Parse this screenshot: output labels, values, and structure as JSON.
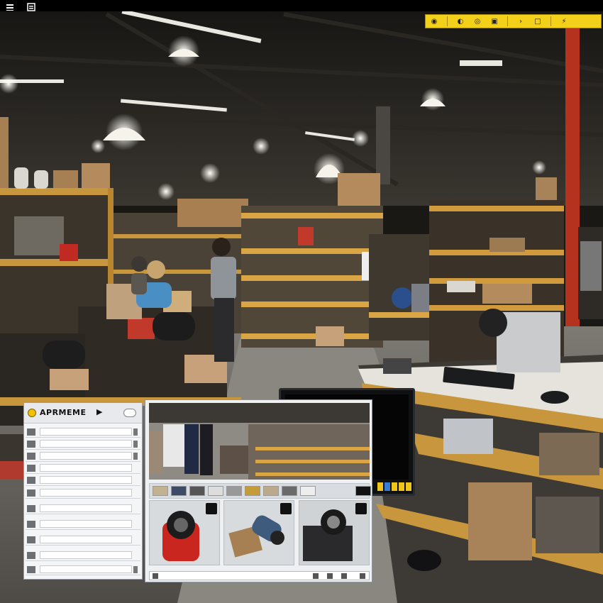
{
  "toolbar": {
    "icons": [
      "target-icon",
      "eye-icon",
      "pin-icon",
      "save-icon",
      "chevron-icon",
      "square-icon",
      "bolt-icon"
    ],
    "glyphs": [
      "◉",
      "◐",
      "◎",
      "▣",
      "›",
      "□",
      "⚡"
    ]
  },
  "app_panel": {
    "title": "APRMEME",
    "play_glyph": "▶"
  },
  "colors": {
    "toolbar_yellow": "#f3d01a",
    "panel_bg": "#f4f5f6",
    "shelf_wood": "#c8963c",
    "red_column": "#b5321f"
  }
}
